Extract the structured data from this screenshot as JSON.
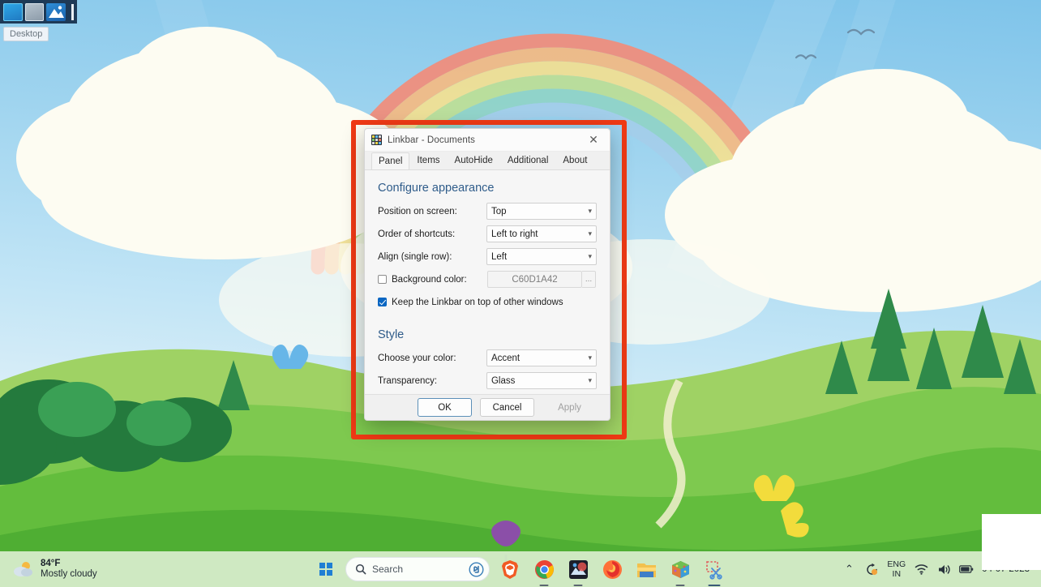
{
  "linkbar": {
    "name": "linkbar-toolbar",
    "tooltip": "Desktop",
    "items": [
      {
        "name": "desktop-icon",
        "label": "Desktop"
      },
      {
        "name": "documents-icon",
        "label": "Documents"
      },
      {
        "name": "pictures-icon",
        "label": "Pictures"
      }
    ]
  },
  "dialog": {
    "title": "Linkbar - Documents",
    "close_label": "✕",
    "tabs": [
      {
        "label": "Panel",
        "active": true
      },
      {
        "label": "Items",
        "active": false
      },
      {
        "label": "AutoHide",
        "active": false
      },
      {
        "label": "Additional",
        "active": false
      },
      {
        "label": "About",
        "active": false
      }
    ],
    "appearance": {
      "heading": "Configure appearance",
      "position_label": "Position on screen:",
      "position_value": "Top",
      "order_label": "Order of shortcuts:",
      "order_value": "Left to right",
      "align_label": "Align (single row):",
      "align_value": "Left",
      "bgcolor_label": "Background color:",
      "bgcolor_value": "C60D1A42",
      "bgcolor_checked": false,
      "ellipsis_label": "...",
      "ontop_label": "Keep the Linkbar on top of other windows",
      "ontop_checked": true
    },
    "style": {
      "heading": "Style",
      "color_label": "Choose your color:",
      "color_value": "Accent",
      "transparency_label": "Transparency:",
      "transparency_value": "Glass"
    },
    "buttons": {
      "ok": "OK",
      "cancel": "Cancel",
      "apply": "Apply"
    },
    "accent_color": "#2f5c8a",
    "highlight_color": "#f03a15"
  },
  "taskbar": {
    "weather_temp": "84°F",
    "weather_condition": "Mostly cloudy",
    "search_placeholder": "Search",
    "apps": [
      {
        "name": "brave-browser",
        "label": "Brave"
      },
      {
        "name": "google-chrome",
        "label": "Google Chrome"
      },
      {
        "name": "photos-app",
        "label": "Photos"
      },
      {
        "name": "firefox-browser",
        "label": "Firefox"
      },
      {
        "name": "file-explorer",
        "label": "File Explorer"
      },
      {
        "name": "cube-app",
        "label": "Cube"
      },
      {
        "name": "snipping-tool",
        "label": "Snipping Tool"
      }
    ],
    "tray": {
      "chevron": "⌃",
      "lang_line1": "ENG",
      "lang_line2": "IN",
      "wifi": "◠",
      "volume": "🔊",
      "battery": "▬",
      "date": "04-07-2023"
    }
  }
}
